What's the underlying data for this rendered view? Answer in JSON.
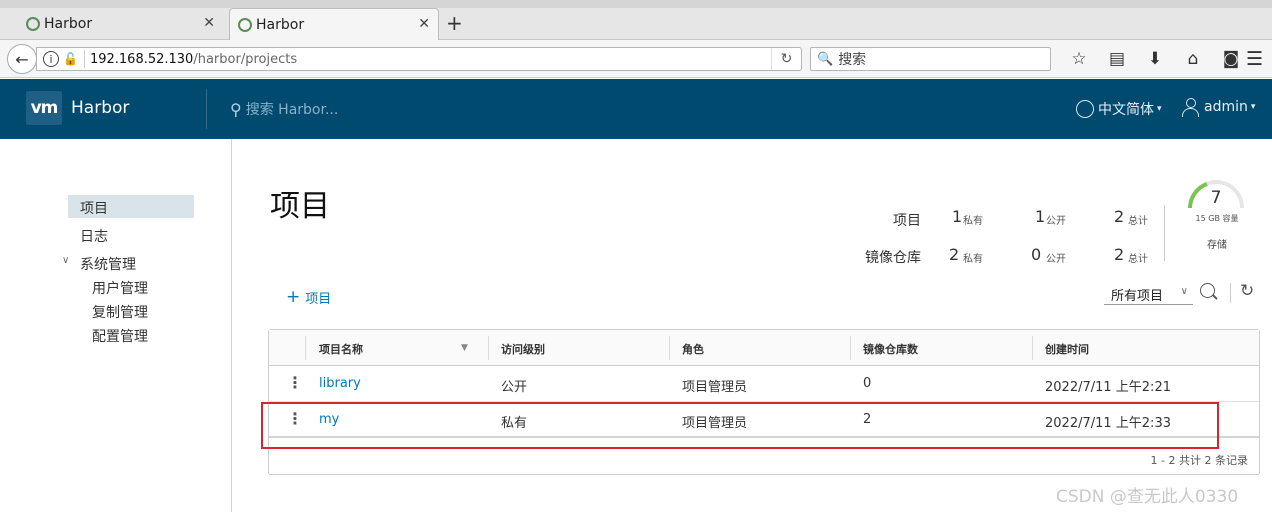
{
  "browser": {
    "tabs": [
      {
        "title": "Harbor",
        "active": false
      },
      {
        "title": "Harbor",
        "active": true
      }
    ],
    "url_host": "192.168.52.130",
    "url_path": "/harbor/projects",
    "search_placeholder": "搜索"
  },
  "header": {
    "logo_text": "vm",
    "app_name": "Harbor",
    "search_placeholder": "搜索 Harbor...",
    "language": "中文简体",
    "user": "admin",
    "bg_color": "#004a70"
  },
  "sidebar": {
    "items": [
      {
        "label": "项目",
        "active": true
      },
      {
        "label": "日志",
        "active": false
      },
      {
        "label": "系统管理",
        "active": false
      }
    ],
    "admin_children": [
      {
        "label": "用户管理"
      },
      {
        "label": "复制管理"
      },
      {
        "label": "配置管理"
      }
    ]
  },
  "main": {
    "title": "项目",
    "stats": {
      "projects_label": "项目",
      "projects_private": "1",
      "projects_public": "1",
      "projects_total": "2",
      "repos_label": "镜像仓库",
      "repos_private": "2",
      "repos_public": "0",
      "repos_total": "2",
      "private_label": "私有",
      "public_label": "公开",
      "total_label": "总计"
    },
    "storage": {
      "value": "7",
      "capacity": "15 GB 容量",
      "label": "存储"
    },
    "add_project_label": "项目",
    "filter_value": "所有项目",
    "grid": {
      "columns": [
        "项目名称",
        "访问级别",
        "角色",
        "镜像仓库数",
        "创建时间"
      ],
      "rows": [
        {
          "name": "library",
          "access": "公开",
          "role": "项目管理员",
          "repo_count": "0",
          "created": "2022/7/11 上午2:21"
        },
        {
          "name": "my",
          "access": "私有",
          "role": "项目管理员",
          "repo_count": "2",
          "created": "2022/7/11 上午2:33"
        }
      ],
      "footer": "1 - 2 共计 2 条记录"
    }
  },
  "watermark": "CSDN @查无此人0330",
  "colors": {
    "link": "#0079b8",
    "highlight": "#d8242f",
    "sidebar_active": "#d9e4ea"
  }
}
